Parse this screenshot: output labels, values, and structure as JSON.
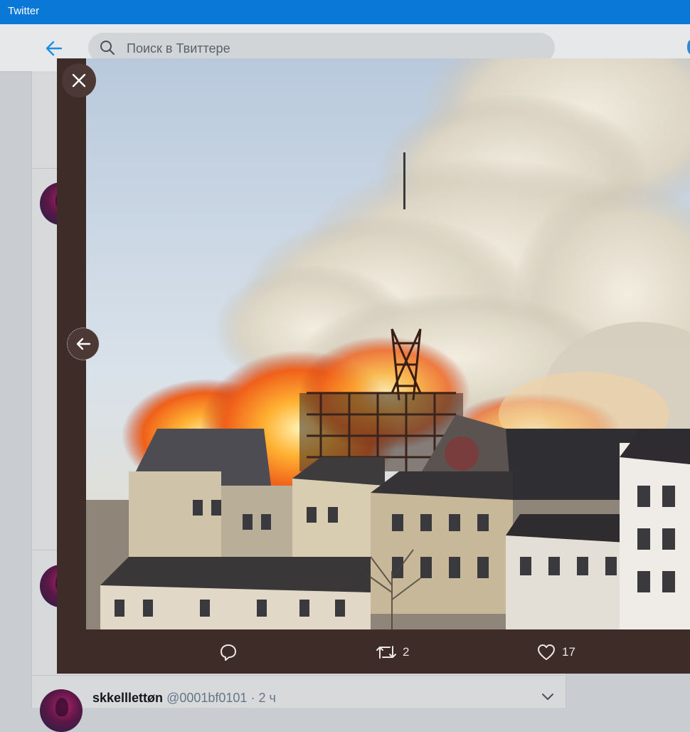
{
  "window": {
    "title": "Twitter"
  },
  "header": {
    "search_placeholder": "Поиск в Твиттере"
  },
  "colors": {
    "titlebar": "#0a78d7",
    "accent": "#1da1f2",
    "modal_background": "#3e2c29"
  },
  "media": {
    "alt": ""
  },
  "actions": {
    "reply": {
      "icon": "reply-icon"
    },
    "retweet": {
      "icon": "retweet-icon",
      "count": "2"
    },
    "like": {
      "icon": "heart-icon",
      "count": "17"
    }
  },
  "timeline": {
    "tweet": {
      "author_name": "skkelllettøn",
      "handle": "@0001bf0101",
      "separator": "·",
      "time": "2 ч"
    }
  }
}
